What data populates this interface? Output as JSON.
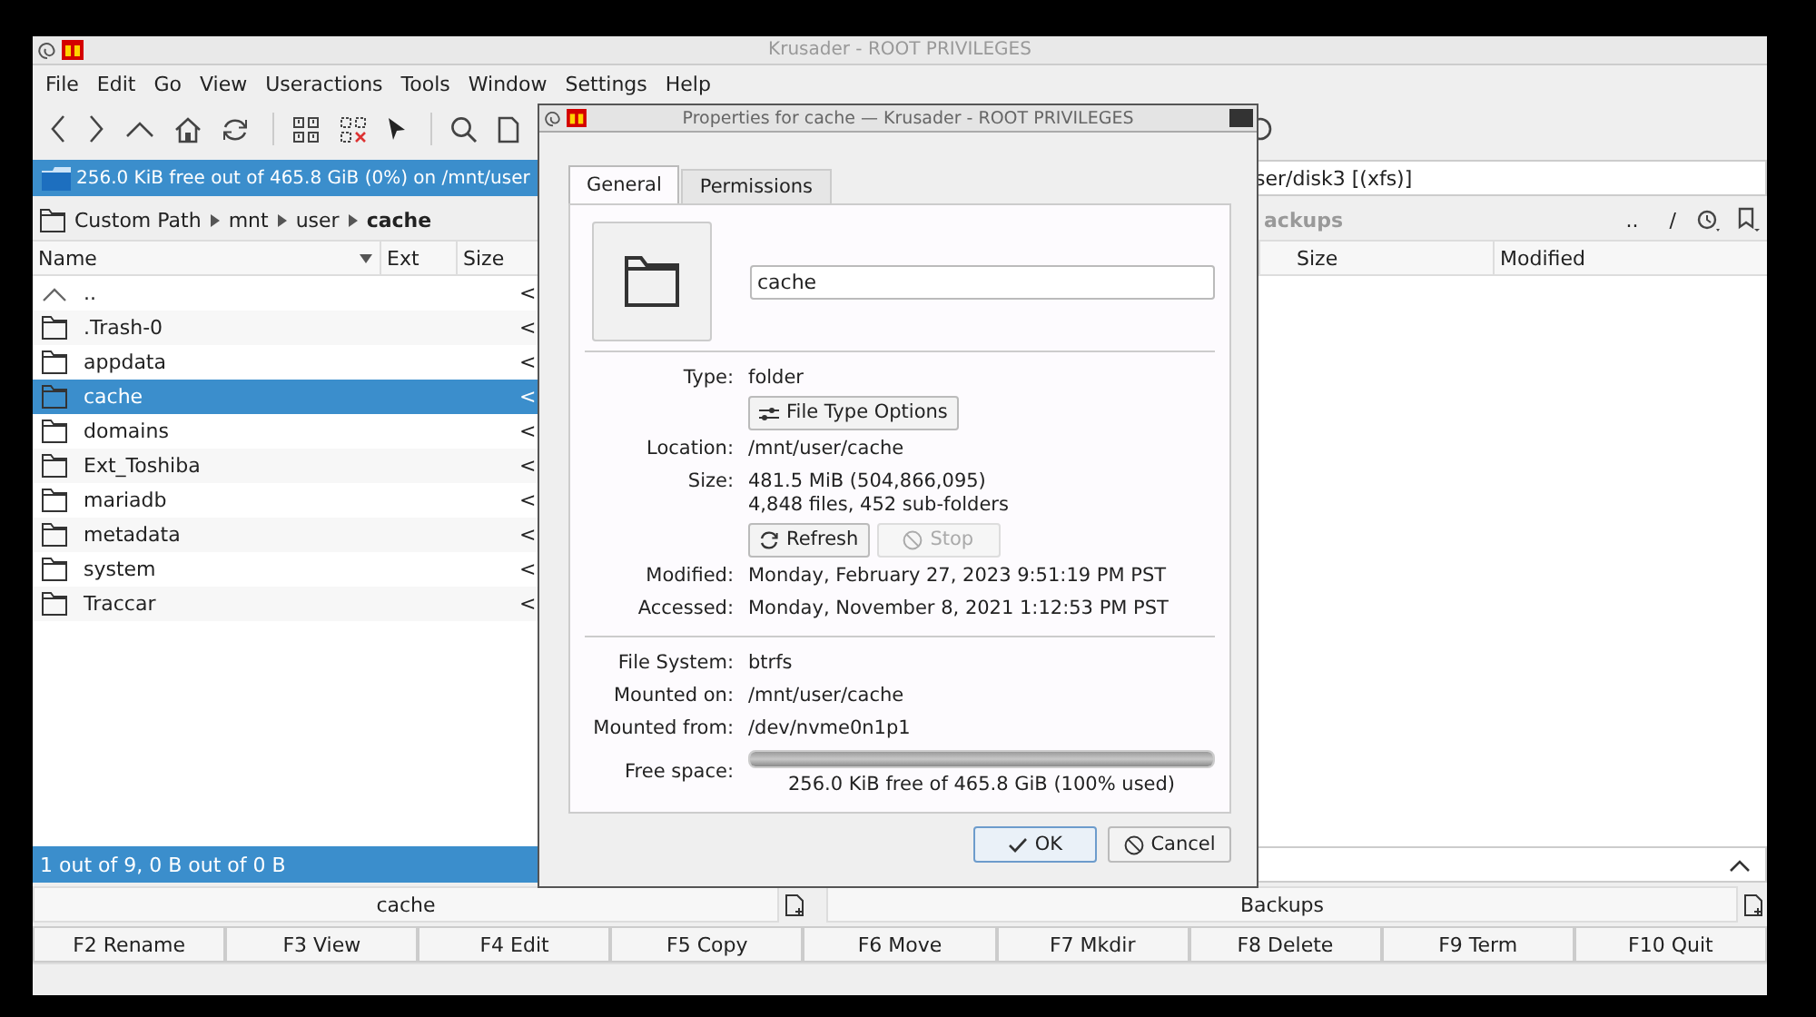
{
  "window": {
    "title": "Krusader - ROOT PRIVILEGES"
  },
  "menu": [
    "File",
    "Edit",
    "Go",
    "View",
    "Useractions",
    "Tools",
    "Window",
    "Settings",
    "Help"
  ],
  "left_panel": {
    "free_space": "256.0 KiB free out of 465.8 GiB (0%) on /mnt/user",
    "breadcrumb": [
      "Custom Path",
      "mnt",
      "user",
      "cache"
    ],
    "columns": [
      "Name",
      "Ext",
      "Size"
    ],
    "rows": [
      {
        "name": "..",
        "kind": "up",
        "size": "<",
        "selected": false
      },
      {
        "name": ".Trash-0",
        "kind": "folder",
        "size": "<",
        "selected": false
      },
      {
        "name": "appdata",
        "kind": "folder",
        "size": "<",
        "selected": false
      },
      {
        "name": "cache",
        "kind": "folder",
        "size": "<",
        "selected": true
      },
      {
        "name": "domains",
        "kind": "folder",
        "size": "<",
        "selected": false
      },
      {
        "name": "Ext_Toshiba",
        "kind": "folder",
        "size": "<",
        "selected": false
      },
      {
        "name": "mariadb",
        "kind": "folder",
        "size": "<",
        "selected": false
      },
      {
        "name": "metadata",
        "kind": "folder",
        "size": "<",
        "selected": false
      },
      {
        "name": "system",
        "kind": "folder",
        "size": "<",
        "selected": false
      },
      {
        "name": "Traccar",
        "kind": "folder",
        "size": "<",
        "selected": false
      }
    ],
    "status": "1 out of 9, 0 B out of 0 B",
    "path_label": "cache"
  },
  "right_panel": {
    "free_space": "ser/disk3 [(xfs)]",
    "title": "ackups",
    "shortcuts": [
      "..",
      "/"
    ],
    "columns": [
      "Size",
      "Modified"
    ],
    "path_label": "Backups"
  },
  "function_keys": [
    "F2 Rename",
    "F3 View",
    "F4 Edit",
    "F5 Copy",
    "F6 Move",
    "F7 Mkdir",
    "F8 Delete",
    "F9 Term",
    "F10 Quit"
  ],
  "dialog": {
    "title": "Properties for cache — Krusader - ROOT PRIVILEGES",
    "tabs": [
      {
        "label": "General",
        "selected": true
      },
      {
        "label": "Permissions",
        "selected": false
      }
    ],
    "name": "cache",
    "items": [
      {
        "kind": "field",
        "label": "Type:",
        "lines": [
          "folder"
        ]
      },
      {
        "kind": "buttons",
        "buttons": [
          {
            "label": "File Type Options",
            "disabled": false
          }
        ]
      },
      {
        "kind": "field",
        "label": "Location:",
        "lines": [
          "/mnt/user/cache"
        ]
      },
      {
        "kind": "field",
        "label": "Size:",
        "lines": [
          "481.5 MiB (504,866,095)",
          "4,848 files, 452 sub-folders"
        ]
      },
      {
        "kind": "buttons",
        "buttons": [
          {
            "label": "Refresh",
            "disabled": false
          },
          {
            "label": "Stop",
            "disabled": true
          }
        ]
      },
      {
        "kind": "field",
        "label": "Modified:",
        "lines": [
          "Monday, February 27, 2023 9:51:19 PM PST"
        ]
      },
      {
        "kind": "field",
        "label": "Accessed:",
        "lines": [
          "Monday, November 8, 2021 1:12:53 PM PST"
        ]
      },
      {
        "kind": "divider"
      },
      {
        "kind": "field",
        "label": "File System:",
        "lines": [
          "btrfs"
        ]
      },
      {
        "kind": "field",
        "label": "Mounted on:",
        "lines": [
          "/mnt/user/cache"
        ]
      },
      {
        "kind": "field",
        "label": "Mounted from:",
        "lines": [
          "/dev/nvme0n1p1"
        ]
      },
      {
        "kind": "meter",
        "label": "Free space:",
        "level": 1.0,
        "reading": "256.0 KiB free of 465.8 GiB (100% used)"
      }
    ],
    "buttons": [
      {
        "label": "OK",
        "selected": true
      },
      {
        "label": "Cancel",
        "selected": false
      }
    ]
  }
}
